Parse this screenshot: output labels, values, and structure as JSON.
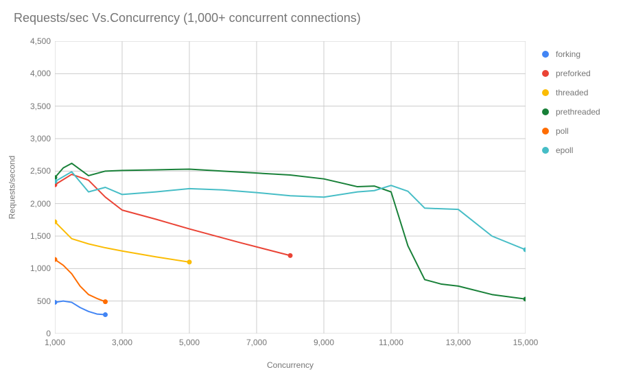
{
  "chart_data": {
    "type": "line",
    "title": "Requests/sec Vs.Concurrency (1,000+ concurrent connections)",
    "xlabel": "Concurrency",
    "ylabel": "Requests/second",
    "xlim": [
      1000,
      15000
    ],
    "ylim": [
      0,
      4500
    ],
    "x_ticks": [
      1000,
      3000,
      5000,
      7000,
      9000,
      11000,
      13000,
      15000
    ],
    "y_ticks": [
      0,
      500,
      1000,
      1500,
      2000,
      2500,
      3000,
      3500,
      4000,
      4500
    ],
    "x_tick_labels": [
      "1,000",
      "3,000",
      "5,000",
      "7,000",
      "9,000",
      "11,000",
      "13,000",
      "15,000"
    ],
    "y_tick_labels": [
      "0",
      "500",
      "1,000",
      "1,500",
      "2,000",
      "2,500",
      "3,000",
      "3,500",
      "4,000",
      "4,500"
    ],
    "series": [
      {
        "name": "forking",
        "color": "#4285f4",
        "x": [
          1000,
          1250,
          1500,
          1750,
          2000,
          2250,
          2500
        ],
        "values": [
          480,
          500,
          480,
          400,
          340,
          300,
          290
        ]
      },
      {
        "name": "preforked",
        "color": "#ea4335",
        "x": [
          1000,
          1500,
          2000,
          2500,
          3000,
          4000,
          5000,
          6500,
          8000
        ],
        "values": [
          2290,
          2450,
          2360,
          2100,
          1900,
          1760,
          1610,
          1400,
          1200
        ]
      },
      {
        "name": "threaded",
        "color": "#fbbc04",
        "x": [
          1000,
          1500,
          2000,
          2500,
          3000,
          4000,
          5000
        ],
        "values": [
          1720,
          1460,
          1380,
          1320,
          1270,
          1180,
          1100
        ]
      },
      {
        "name": "prethreaded",
        "color": "#188038",
        "x": [
          1000,
          1250,
          1500,
          2000,
          2500,
          3000,
          4000,
          5000,
          6000,
          7000,
          8000,
          9000,
          10000,
          10500,
          11000,
          11500,
          12000,
          12500,
          13000,
          14000,
          15000
        ],
        "values": [
          2400,
          2550,
          2620,
          2430,
          2500,
          2510,
          2520,
          2530,
          2500,
          2470,
          2440,
          2380,
          2260,
          2270,
          2180,
          1350,
          830,
          760,
          730,
          600,
          530
        ]
      },
      {
        "name": "poll",
        "color": "#ff6d01",
        "x": [
          1000,
          1250,
          1500,
          1750,
          2000,
          2250,
          2500
        ],
        "values": [
          1140,
          1050,
          920,
          730,
          600,
          540,
          490
        ]
      },
      {
        "name": "epoll",
        "color": "#46bdc6",
        "x": [
          1000,
          1500,
          2000,
          2500,
          3000,
          4000,
          5000,
          6000,
          7000,
          8000,
          9000,
          10000,
          10500,
          11000,
          11500,
          12000,
          13000,
          14000,
          15000
        ],
        "values": [
          2340,
          2490,
          2180,
          2250,
          2140,
          2180,
          2230,
          2210,
          2170,
          2120,
          2100,
          2180,
          2200,
          2280,
          2190,
          1930,
          1910,
          1500,
          1290
        ]
      }
    ]
  }
}
